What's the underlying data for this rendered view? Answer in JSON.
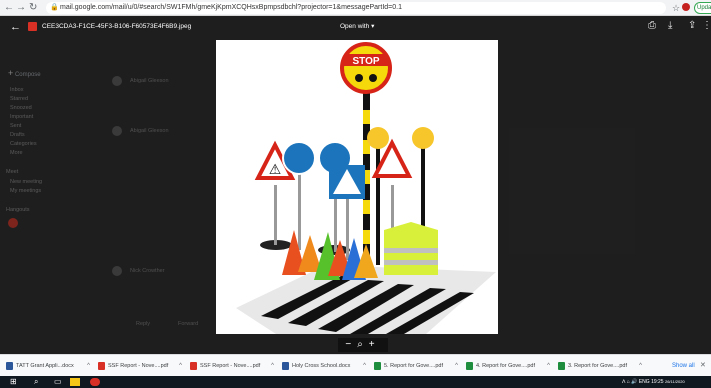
{
  "browser": {
    "url": "mail.google.com/mail/u/0/#search/SW1FMh/gmeKjKpmXCQHsxBpmpsdbchl?projector=1&messagePartId=0.1",
    "update_label": "Update"
  },
  "viewer": {
    "filename": "CEE3CDA3-F1CE-45F3-B106-F60573E4F6B9.jpeg",
    "open_with": "Open with",
    "zoom_out": "−",
    "zoom_in": "+"
  },
  "gmail_bg": {
    "compose": "Compose",
    "sidebar": [
      "Inbox",
      "Starred",
      "Snoozed",
      "Important",
      "Sent",
      "Drafts",
      "Categories",
      "More"
    ],
    "sidebar_more": [
      "Meet",
      "New meeting",
      "My meetings",
      "Hangouts"
    ],
    "mail_items": [
      "Abigail Gleeson",
      "Abigail Gleeson",
      "Nick Crowther"
    ],
    "reply": "Reply",
    "forward": "Forward"
  },
  "downloads": [
    {
      "name": "TATT Grant Appli...docx",
      "color": "#2b579a"
    },
    {
      "name": "SSF Report - Nove....pdf",
      "color": "#d93025"
    },
    {
      "name": "SSF Report - Nove....pdf",
      "color": "#d93025"
    },
    {
      "name": "Holy Cross School.docx",
      "color": "#2b579a"
    },
    {
      "name": "5. Report for Gove....pdf",
      "color": "#1e8e3e"
    },
    {
      "name": "4. Report for Gove....pdf",
      "color": "#1e8e3e"
    },
    {
      "name": "3. Report for Gove....pdf",
      "color": "#1e8e3e"
    }
  ],
  "shelf": {
    "show_all": "Show all"
  },
  "tray": {
    "lang": "ENG",
    "time": "19:25",
    "date": "26/11/2020"
  },
  "photo": {
    "stop_sign": "STOP"
  }
}
